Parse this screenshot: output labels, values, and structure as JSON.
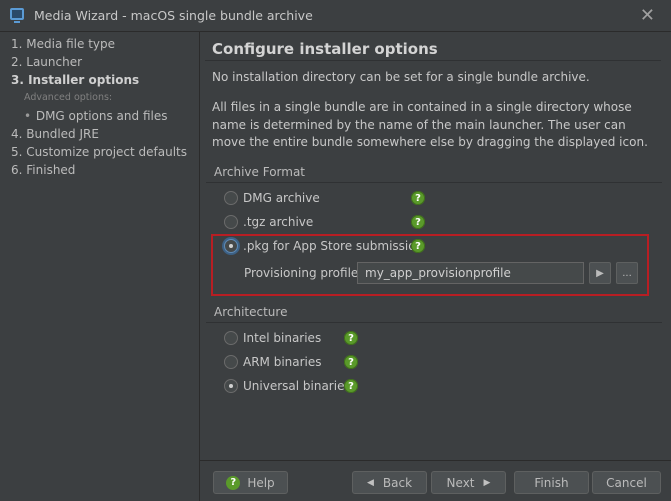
{
  "window": {
    "title": "Media Wizard - macOS single bundle archive",
    "close_glyph": "✕"
  },
  "steps": {
    "items": [
      {
        "label": "1. Media file type"
      },
      {
        "label": "2. Launcher"
      },
      {
        "label": "3. Installer options"
      },
      {
        "label": "4. Bundled JRE"
      },
      {
        "label": "5. Customize project defaults"
      },
      {
        "label": "6. Finished"
      }
    ],
    "advanced_header": "Advanced options:",
    "sub_item": "DMG options and files",
    "bullet": "•",
    "current_index": 2
  },
  "main": {
    "heading": "Configure installer options",
    "note": "No installation directory can be set for a single bundle archive.",
    "description": "All files in a single bundle are in contained in a single directory whose name is determined by the name of the main launcher. The user can move the entire bundle somewhere else by dragging the displayed icon.",
    "archive_format": {
      "label": "Archive Format",
      "options": [
        {
          "label": "DMG archive",
          "checked": false
        },
        {
          "label": ".tgz archive",
          "checked": false
        },
        {
          "label": ".pkg for App Store submission",
          "checked": true
        }
      ],
      "provisioning_label": "Provisioning profile:",
      "provisioning_value": "my_app_provisionprofile",
      "play_glyph": "▶",
      "browse_glyph": "..."
    },
    "architecture": {
      "label": "Architecture",
      "options": [
        {
          "label": "Intel binaries",
          "checked": false
        },
        {
          "label": "ARM binaries",
          "checked": false
        },
        {
          "label": "Universal binaries",
          "checked": true
        }
      ]
    },
    "help_glyph": "?"
  },
  "buttons": {
    "help": "Help",
    "back": "Back",
    "next": "Next",
    "finish": "Finish",
    "cancel": "Cancel",
    "back_glyph": "◀",
    "next_glyph": "▶"
  },
  "colors": {
    "background": "#3c3f41",
    "highlight": "#b81e23",
    "help_icon": "#5a9a2a"
  }
}
